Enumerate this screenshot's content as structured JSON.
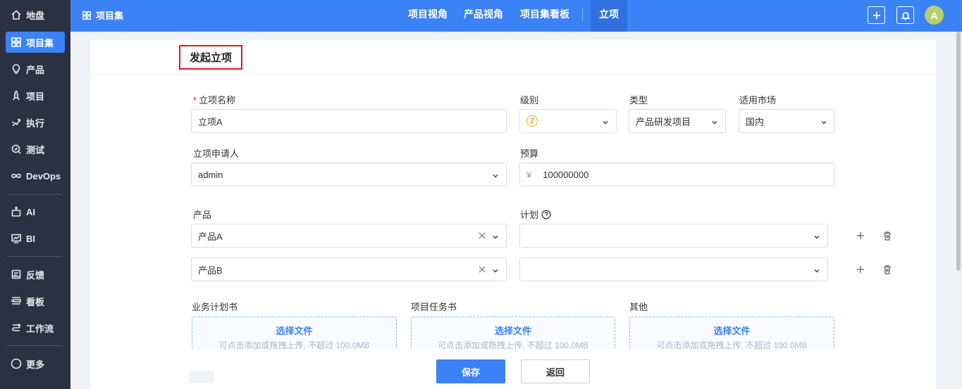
{
  "sidebar": {
    "items": [
      {
        "label": "地盘",
        "icon": "home-icon"
      },
      {
        "label": "项目集",
        "icon": "grid-icon"
      },
      {
        "label": "产品",
        "icon": "bulb-icon"
      },
      {
        "label": "项目",
        "icon": "rocket-icon"
      },
      {
        "label": "执行",
        "icon": "run-icon"
      },
      {
        "label": "测试",
        "icon": "test-icon"
      },
      {
        "label": "DevOps",
        "icon": "infinity-icon"
      },
      {
        "label": "AI",
        "icon": "robot-icon"
      },
      {
        "label": "BI",
        "icon": "chart-icon"
      },
      {
        "label": "反馈",
        "icon": "feedback-icon"
      },
      {
        "label": "看板",
        "icon": "kanban-icon"
      },
      {
        "label": "工作流",
        "icon": "workflow-icon"
      },
      {
        "label": "更多",
        "icon": "more-icon"
      }
    ]
  },
  "topbar": {
    "breadcrumb": "项目集",
    "nav": [
      "项目视角",
      "产品视角",
      "项目集看板",
      "立项"
    ]
  },
  "avatar": "A",
  "form": {
    "title": "发起立项",
    "name_label": "立项名称",
    "name_value": "立项A",
    "level_label": "级别",
    "level_value": "2",
    "type_label": "类型",
    "type_value": "产品研发项目",
    "market_label": "适用市场",
    "market_value": "国内",
    "applicant_label": "立项申请人",
    "applicant_value": "admin",
    "budget_label": "预算",
    "budget_currency": "¥",
    "budget_value": "100000000",
    "product_label": "产品",
    "plan_label": "计划",
    "products": [
      {
        "product": "产品A",
        "plan": ""
      },
      {
        "product": "产品B",
        "plan": ""
      }
    ],
    "uploads": [
      {
        "label": "业务计划书",
        "button": "选择文件",
        "hint": "可点击添加或拖拽上传, 不超过 100.0MB"
      },
      {
        "label": "项目任务书",
        "button": "选择文件",
        "hint": "可点击添加或拖拽上传, 不超过 100.0MB"
      },
      {
        "label": "其他",
        "button": "选择文件",
        "hint": "可点击添加或拖拽上传, 不超过 100.0MB"
      }
    ],
    "save": "保存",
    "back": "返回"
  },
  "colors": {
    "accent": "#3b82f6",
    "sidebar": "#2b3142",
    "required": "#e0182a",
    "level": "#f5a623"
  }
}
